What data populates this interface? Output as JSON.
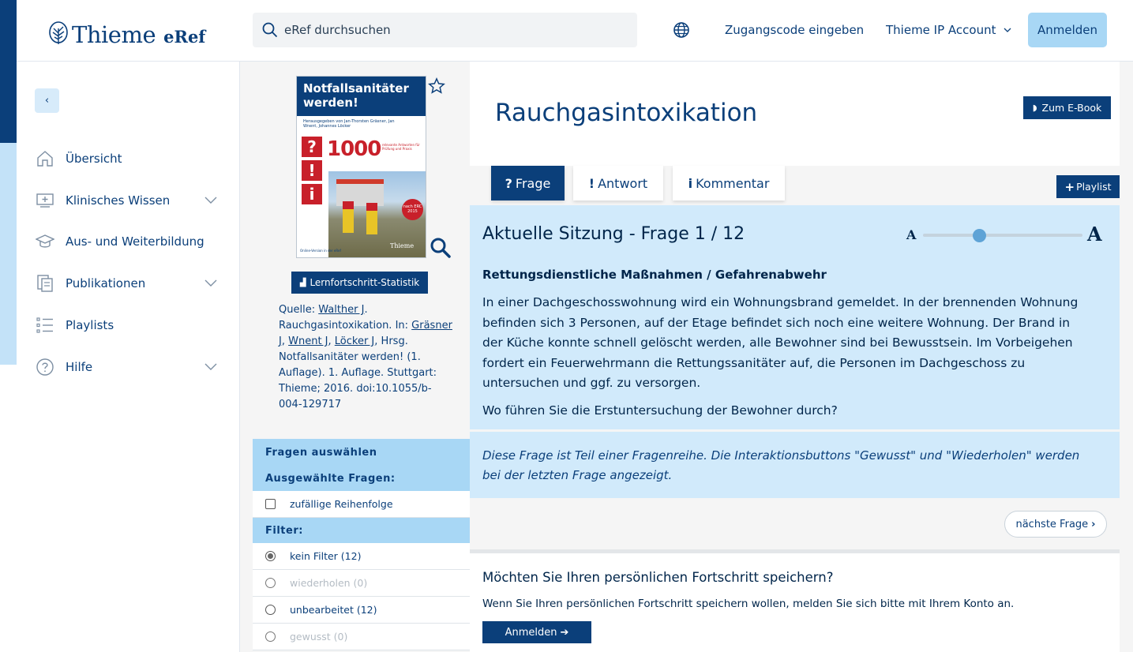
{
  "header": {
    "logo_name": "Thieme",
    "logo_sub": "eRef",
    "search_placeholder": "eRef durchsuchen",
    "access_code_link": "Zugangscode eingeben",
    "ip_account_link": "Thieme IP Account",
    "login_button": "Anmelden"
  },
  "nav": {
    "back_symbol": "‹",
    "items": [
      {
        "label": "Übersicht",
        "icon": "home-icon",
        "has_chevron": false
      },
      {
        "label": "Klinisches Wissen",
        "icon": "monitor-medical-icon",
        "has_chevron": true
      },
      {
        "label": "Aus- und Weiterbildung",
        "icon": "graduation-cap-icon",
        "has_chevron": false
      },
      {
        "label": "Publikationen",
        "icon": "documents-icon",
        "has_chevron": true
      },
      {
        "label": "Playlists",
        "icon": "list-icon",
        "has_chevron": false
      },
      {
        "label": "Hilfe",
        "icon": "help-circle-icon",
        "has_chevron": true
      }
    ]
  },
  "book": {
    "cover_title": "Notfallsanitäter werden!",
    "cover_editors": "Herausgegeben von Jan-Thorsten Gräsner, Jan Wnent, Johannes Löcker",
    "cover_number": "1000",
    "cover_tagline": "relevante Antworten für Prüfung und Praxis",
    "cover_marks": [
      "?",
      "!",
      "i"
    ],
    "cover_badge": "nach ERC 2015",
    "cover_footer": "Online-Version in der eRef",
    "cover_brand": "Thieme",
    "stats_button": "Lernfortschritt-Statistik",
    "source_prefix": "Quelle:",
    "source_author": "Walther J",
    "source_mid1": ". Rauchgasintoxikation. In:",
    "source_ed1": "Gräsner J",
    "source_ed2": "Wnent J",
    "source_ed3": "Löcker J",
    "source_rest": ", Hrsg. Notfallsanitäter werden! (1. Auflage). 1. Auflage. Stuttgart: Thieme; 2016. doi:10.1055/b-004-129717"
  },
  "filters": {
    "select_header": "Fragen auswählen",
    "selected_header": "Ausgewählte Fragen:",
    "random_order": "zufällige Reihenfolge",
    "filter_header": "Filter:",
    "options": [
      {
        "label": "kein Filter (12)",
        "checked": true,
        "disabled": false
      },
      {
        "label": "wiederholen (0)",
        "checked": false,
        "disabled": true
      },
      {
        "label": "unbearbeitet (12)",
        "checked": false,
        "disabled": false
      },
      {
        "label": "gewusst (0)",
        "checked": false,
        "disabled": true
      }
    ]
  },
  "main": {
    "title": "Rauchgasintoxikation",
    "ebook_button": "Zum E-Book",
    "tabs": [
      {
        "symbol": "?",
        "label": "Frage",
        "active": true
      },
      {
        "symbol": "!",
        "label": "Antwort",
        "active": false
      },
      {
        "symbol": "i",
        "label": "Kommentar",
        "active": false
      }
    ],
    "playlist_button": "Playlist",
    "session_label": "Aktuelle Sitzung - Frage 1 / 12",
    "font_small": "A",
    "font_large": "A",
    "font_size_level": 0.35,
    "question_category": "Rettungsdienstliche Maßnahmen / Gefahrenabwehr",
    "question_text": "In einer Dachgeschosswohnung wird ein Wohnungsbrand gemeldet. In der brennenden Wohnung befinden sich 3 Personen, auf der Etage befindet sich noch eine weitere Wohnung. Der Brand in der Küche konnte schnell gelöscht werden, alle Bewohner sind bei Bewusstsein. Im Vorbeigehen fordert ein Feuerwehrmann die Rettungssanitäter auf, die Personen im Dachgeschoss zu untersuchen und ggf. zu versorgen.",
    "question_ask": "Wo führen Sie die Erstuntersuchung der Bewohner durch?",
    "notice": "Diese Frage ist Teil einer Fragenreihe. Die Interaktionsbuttons \"Gewusst\" und \"Wiederholen\" werden bei der letzten Frage angezeigt.",
    "next_button": "nächste Frage",
    "save_title": "Möchten Sie Ihren persönlichen Fortschritt speichern?",
    "save_text": "Wenn Sie Ihren persönlichen Fortschritt speichern wollen, melden Sie sich bitte mit Ihrem Konto an.",
    "save_login_button": "Anmelden"
  },
  "colors": {
    "brand_dark": "#0b3f7a",
    "brand_light": "#a8d7f5",
    "question_bg": "#d1eafb"
  }
}
